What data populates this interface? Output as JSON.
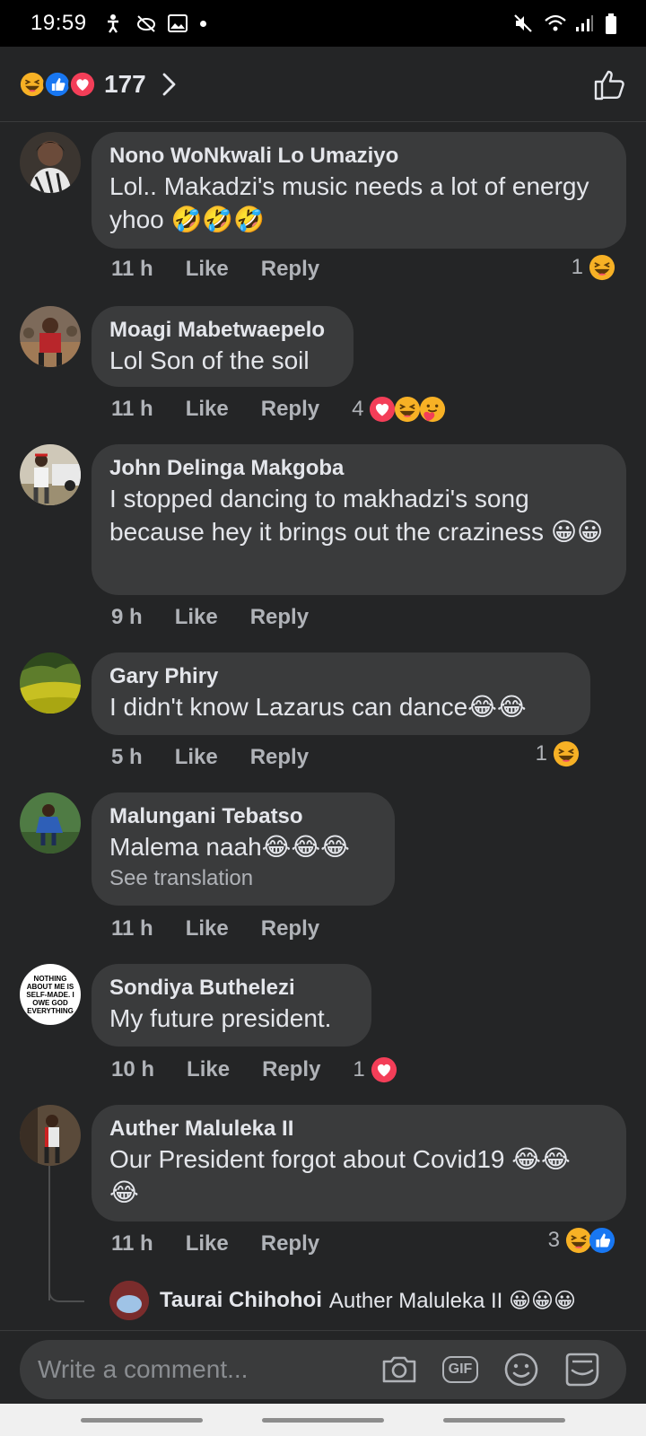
{
  "status_bar": {
    "time": "19:59"
  },
  "header": {
    "reaction_count": "177"
  },
  "comments": [
    {
      "author": "Nono WoNkwali Lo Umaziyo",
      "text": "Lol.. Makadzi's music needs a lot of energy yhoo 🤣🤣🤣",
      "time": "11 h",
      "like": "Like",
      "reply": "Reply",
      "reaction_count": "1"
    },
    {
      "author": "Moagi Mabetwaepelo",
      "text": "Lol Son of the soil",
      "time": "11 h",
      "like": "Like",
      "reply": "Reply",
      "reaction_count": "4"
    },
    {
      "author": "John Delinga Makgoba",
      "text": "I stopped dancing to makhadzi's song because hey it brings out the craziness 😀😀",
      "time": "9 h",
      "like": "Like",
      "reply": "Reply"
    },
    {
      "author": "Gary Phiry",
      "text": "I didn't know Lazarus can dance😂😂",
      "time": "5 h",
      "like": "Like",
      "reply": "Reply",
      "reaction_count": "1"
    },
    {
      "author": "Malungani Tebatso",
      "text": "Malema naah😂😂😂",
      "translation": "See translation",
      "time": "11 h",
      "like": "Like",
      "reply": "Reply"
    },
    {
      "author": "Sondiya Buthelezi",
      "text": "My future president.",
      "time": "10 h",
      "like": "Like",
      "reply": "Reply",
      "reaction_count": "1",
      "avatar_text": "NOTHING ABOUT ME IS SELF-MADE. I OWE GOD EVERYTHING"
    },
    {
      "author": "Auther Maluleka II",
      "text": "Our President forgot about Covid19 😂😂😂",
      "time": "11 h",
      "like": "Like",
      "reply": "Reply",
      "reaction_count": "3"
    }
  ],
  "reply_preview": {
    "author": "Taurai Chihohoi",
    "text": "Auther Maluleka II 😀😀😀"
  },
  "composer": {
    "placeholder": "Write a comment...",
    "gif_label": "GIF"
  },
  "colors": {
    "background": "#242526",
    "bubble": "#3a3b3c",
    "like_blue": "#1877f2",
    "love_red": "#f33e58",
    "haha_yellow": "#f7b125"
  },
  "icons": [
    "laugh-reaction-icon",
    "like-reaction-icon",
    "love-reaction-icon",
    "chevron-right-icon",
    "thumbs-up-icon",
    "camera-icon",
    "gif-icon",
    "smiley-icon",
    "sticker-icon"
  ]
}
